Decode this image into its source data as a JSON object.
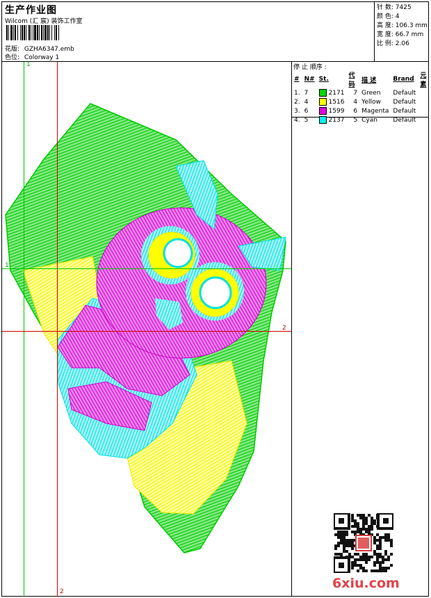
{
  "header": {
    "title": "生产作业图",
    "company": "Wilcom (汇 宸) 装饰工作室",
    "design_label": "花版:",
    "design_value": "GZHA6347.emb",
    "colorway_label": "色位:",
    "colorway_value": "Colorway 1"
  },
  "stats": {
    "stitches_label": "针 数:",
    "stitches_value": "7425",
    "colors_label": "颜 色:",
    "colors_value": "4",
    "height_label": "高 度:",
    "height_value": "106.3 mm",
    "width_label": "宽 度:",
    "width_value": "66.7 mm",
    "scale_label": "比 例:",
    "scale_value": "2.06"
  },
  "stop_sequence": {
    "title": "停 止 顺序 :",
    "headers": [
      "#",
      "N#",
      "St.",
      "代 码",
      "描 述",
      "Brand",
      "元 素"
    ],
    "rows": [
      {
        "index": "1.",
        "n": "7",
        "color": "#00d800",
        "st": "2171",
        "code": "7",
        "desc": "Green",
        "brand": "Default"
      },
      {
        "index": "2.",
        "n": "4",
        "color": "#ffff00",
        "st": "1516",
        "code": "4",
        "desc": "Yellow",
        "brand": "Default"
      },
      {
        "index": "3.",
        "n": "6",
        "color": "#e000e0",
        "st": "1599",
        "code": "6",
        "desc": "Magenta",
        "brand": "Default"
      },
      {
        "index": "4.",
        "n": "5",
        "color": "#00f0f0",
        "st": "2137",
        "code": "5",
        "desc": "Cyan",
        "brand": "Default"
      }
    ]
  },
  "guides": {
    "v1_top": "1",
    "h1_left": "1",
    "h2_right": "2",
    "v2_bottom": "2"
  },
  "watermark": {
    "site": "6xiu.com",
    "seal_text": "印章"
  },
  "colors": {
    "green": "#00d800",
    "yellow": "#ffff00",
    "magenta": "#e000e0",
    "cyan": "#00f0f0",
    "guide_green": "#00c800",
    "guide_red": "#d00000",
    "brand_red": "#e2434a"
  }
}
